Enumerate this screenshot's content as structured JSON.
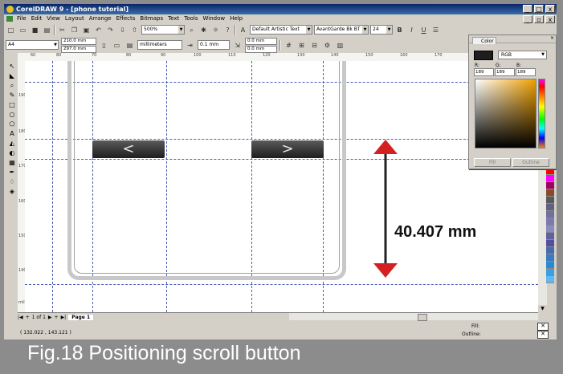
{
  "window": {
    "title": "CorelDRAW 9 - [phone tutorial]",
    "min": "_",
    "max": "□",
    "close": "x"
  },
  "menu": [
    "File",
    "Edit",
    "View",
    "Layout",
    "Arrange",
    "Effects",
    "Bitmaps",
    "Text",
    "Tools",
    "Window",
    "Help"
  ],
  "toolbar": {
    "zoom": "500%",
    "font_style": "Default Artistic Text",
    "font_name": "AvantGarde Bk BT",
    "font_size": "24",
    "bold": "B",
    "italic": "I",
    "underline": "U"
  },
  "propbar": {
    "page_size": "A4",
    "width": "210.0 mm",
    "height": "297.0 mm",
    "units": "millimeters",
    "nudge": "0.1 mm",
    "dup_x": "0.0 mm",
    "dup_y": "0.0 mm"
  },
  "ruler": {
    "h_ticks": [
      "60",
      "80",
      "70",
      "80",
      "90",
      "100",
      "110",
      "120",
      "130",
      "140",
      "150",
      "160",
      "170"
    ],
    "v_ticks": [
      "190",
      "180",
      "170",
      "160",
      "150",
      "140",
      "130"
    ],
    "units": "millimeters"
  },
  "canvas": {
    "left_button": "<",
    "right_button": ">",
    "measurement": "40.407 mm"
  },
  "pages": {
    "counter": "1 of 1",
    "tab": "Page 1"
  },
  "status": {
    "coords": "( 132.022 , 143.121 )",
    "fill_label": "Fill:",
    "outline_label": "Outline:"
  },
  "docker": {
    "tab": "Color",
    "model": "RGB",
    "r_label": "R:",
    "g_label": "G:",
    "b_label": "B:",
    "r": "189",
    "g": "189",
    "b": "189",
    "fill_button": "Fill",
    "outline_button": "Outline"
  },
  "caption": "Fig.18  Positioning scroll button",
  "colors": {
    "arrow": "#d42020",
    "guides": "#4b5fb5",
    "title": "#0a246a"
  },
  "palette": [
    "#ffff00",
    "#ff0000",
    "#ff00ff",
    "#a00060",
    "#8a4a2a",
    "#5a5a5a",
    "#606080",
    "#7070a0",
    "#7a7ab0",
    "#8a8ac0",
    "#6060a0",
    "#5050a0",
    "#4a6ab0",
    "#3a7ac0",
    "#2a8ad0",
    "#3aa0e0",
    "#60b8f0"
  ]
}
